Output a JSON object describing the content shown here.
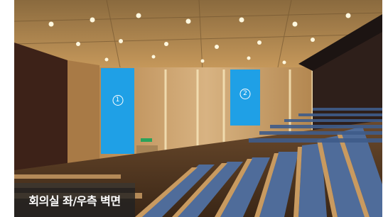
{
  "photo": {
    "subject": "auditorium-interior-photo",
    "panel_color": "#1fa0e6",
    "panels": [
      {
        "label": "1"
      },
      {
        "label": "2"
      }
    ]
  },
  "caption": {
    "text": "회의실 좌/우측 벽면"
  }
}
